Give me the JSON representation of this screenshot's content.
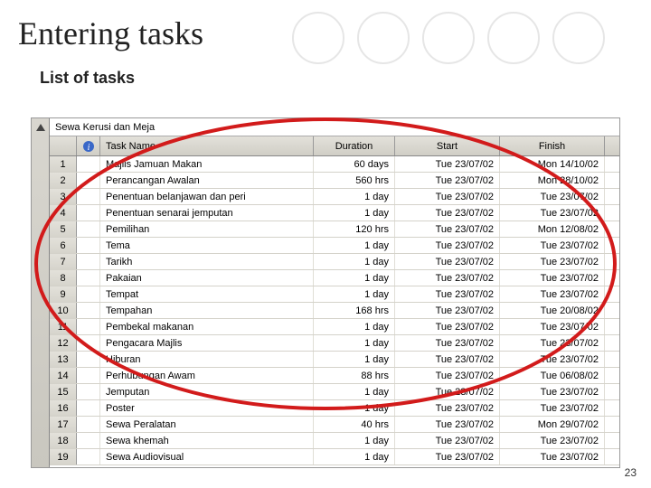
{
  "slide": {
    "title": "Entering tasks",
    "subtitle": "List of tasks",
    "page_number": "23"
  },
  "project": {
    "formula_bar": "Sewa Kerusi dan Meja",
    "columns": {
      "name": "Task Name",
      "duration": "Duration",
      "start": "Start",
      "finish": "Finish"
    },
    "rows": [
      {
        "id": "1",
        "name": "Majlis Jamuan Makan",
        "dur": "60 days",
        "start": "Tue 23/07/02",
        "fin": "Mon 14/10/02"
      },
      {
        "id": "2",
        "name": "Perancangan Awalan",
        "dur": "560 hrs",
        "start": "Tue 23/07/02",
        "fin": "Mon 28/10/02"
      },
      {
        "id": "3",
        "name": "Penentuan belanjawan dan peri",
        "dur": "1 day",
        "start": "Tue 23/07/02",
        "fin": "Tue 23/07/02"
      },
      {
        "id": "4",
        "name": "Penentuan senarai jemputan",
        "dur": "1 day",
        "start": "Tue 23/07/02",
        "fin": "Tue 23/07/02"
      },
      {
        "id": "5",
        "name": "Pemilihan",
        "dur": "120 hrs",
        "start": "Tue 23/07/02",
        "fin": "Mon 12/08/02"
      },
      {
        "id": "6",
        "name": "Tema",
        "dur": "1 day",
        "start": "Tue 23/07/02",
        "fin": "Tue 23/07/02"
      },
      {
        "id": "7",
        "name": "Tarikh",
        "dur": "1 day",
        "start": "Tue 23/07/02",
        "fin": "Tue 23/07/02"
      },
      {
        "id": "8",
        "name": "Pakaian",
        "dur": "1 day",
        "start": "Tue 23/07/02",
        "fin": "Tue 23/07/02"
      },
      {
        "id": "9",
        "name": "Tempat",
        "dur": "1 day",
        "start": "Tue 23/07/02",
        "fin": "Tue 23/07/02"
      },
      {
        "id": "10",
        "name": "Tempahan",
        "dur": "168 hrs",
        "start": "Tue 23/07/02",
        "fin": "Tue 20/08/02"
      },
      {
        "id": "11",
        "name": "Pembekal makanan",
        "dur": "1 day",
        "start": "Tue 23/07/02",
        "fin": "Tue 23/07/02"
      },
      {
        "id": "12",
        "name": "Pengacara Majlis",
        "dur": "1 day",
        "start": "Tue 23/07/02",
        "fin": "Tue 23/07/02"
      },
      {
        "id": "13",
        "name": "Hiburan",
        "dur": "1 day",
        "start": "Tue 23/07/02",
        "fin": "Tue 23/07/02"
      },
      {
        "id": "14",
        "name": "Perhubungan Awam",
        "dur": "88 hrs",
        "start": "Tue 23/07/02",
        "fin": "Tue 06/08/02"
      },
      {
        "id": "15",
        "name": "Jemputan",
        "dur": "1 day",
        "start": "Tue 23/07/02",
        "fin": "Tue 23/07/02"
      },
      {
        "id": "16",
        "name": "Poster",
        "dur": "1 day",
        "start": "Tue 23/07/02",
        "fin": "Tue 23/07/02"
      },
      {
        "id": "17",
        "name": "Sewa Peralatan",
        "dur": "40 hrs",
        "start": "Tue 23/07/02",
        "fin": "Mon 29/07/02"
      },
      {
        "id": "18",
        "name": "Sewa khemah",
        "dur": "1 day",
        "start": "Tue 23/07/02",
        "fin": "Tue 23/07/02"
      },
      {
        "id": "19",
        "name": "Sewa Audiovisual",
        "dur": "1 day",
        "start": "Tue 23/07/02",
        "fin": "Tue 23/07/02"
      }
    ]
  }
}
